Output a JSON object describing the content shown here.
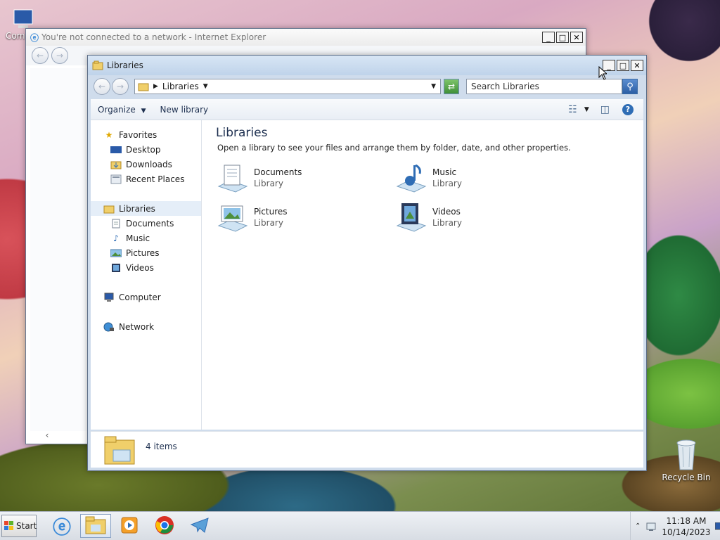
{
  "desktop": {
    "computer_icon_label": "Com",
    "recycle_bin_label": "Recycle Bin"
  },
  "ie_window": {
    "title": "You're not connected to a network - Internet Explorer"
  },
  "explorer": {
    "title": "Libraries",
    "breadcrumb": "Libraries",
    "search_placeholder": "Search Libraries",
    "toolbar": {
      "organize": "Organize",
      "new_library": "New library"
    },
    "nav": {
      "favorites": "Favorites",
      "favorites_items": [
        "Desktop",
        "Downloads",
        "Recent Places"
      ],
      "libraries": "Libraries",
      "libraries_items": [
        "Documents",
        "Music",
        "Pictures",
        "Videos"
      ],
      "computer": "Computer",
      "network": "Network"
    },
    "content": {
      "heading": "Libraries",
      "description": "Open a library to see your files and arrange them by folder, date, and other properties.",
      "items": [
        {
          "name": "Documents",
          "type": "Library"
        },
        {
          "name": "Music",
          "type": "Library"
        },
        {
          "name": "Pictures",
          "type": "Library"
        },
        {
          "name": "Videos",
          "type": "Library"
        }
      ]
    },
    "status": {
      "count": "4 items"
    }
  },
  "taskbar": {
    "start_label": "Start",
    "time": "11:18 AM",
    "date": "10/14/2023"
  },
  "colors": {
    "title_active": "#c6d9ee",
    "selection": "#e5eef8",
    "accent": "#1e3050"
  }
}
